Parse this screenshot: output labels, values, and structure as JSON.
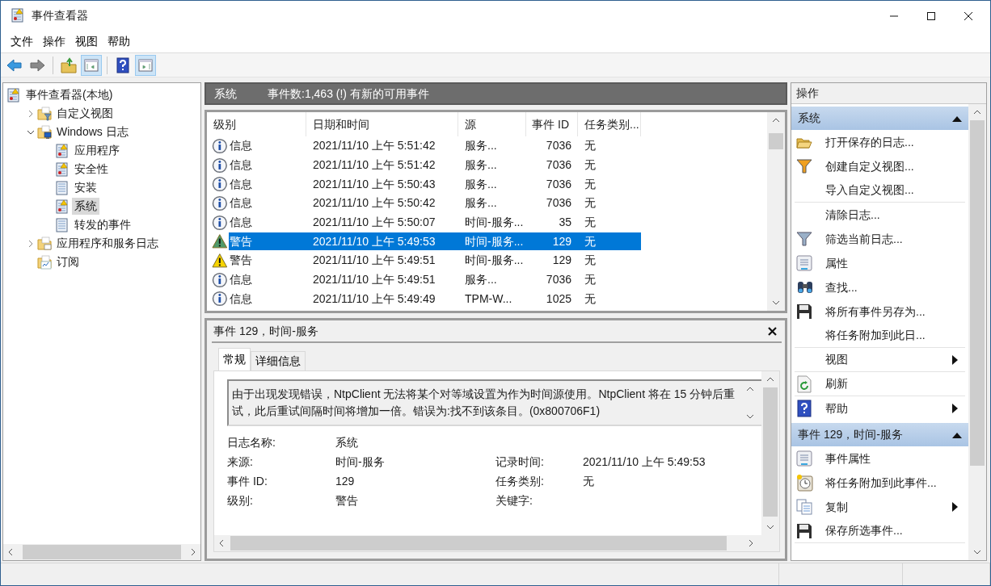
{
  "window": {
    "title": "事件查看器"
  },
  "menu": [
    "文件",
    "操作",
    "视图",
    "帮助"
  ],
  "toolbar": [
    {
      "kind": "back",
      "pressed": false
    },
    {
      "kind": "forward",
      "pressed": false
    },
    {
      "kind": "up",
      "pressed": false
    },
    {
      "kind": "tree-pane",
      "pressed": true
    },
    {
      "kind": "help",
      "pressed": false
    },
    {
      "kind": "action-pane",
      "pressed": true
    }
  ],
  "tree": [
    {
      "label": "事件查看器(本地)",
      "kind": "log",
      "selected": false,
      "children": [
        {
          "label": "自定义视图",
          "kind": "folder-filter",
          "expanded": false,
          "selected": false
        },
        {
          "label": "Windows 日志",
          "kind": "folder-windows",
          "expanded": true,
          "selected": false,
          "children": [
            {
              "label": "应用程序",
              "kind": "log",
              "selected": false
            },
            {
              "label": "安全性",
              "kind": "log",
              "selected": false
            },
            {
              "label": "安装",
              "kind": "page",
              "selected": false
            },
            {
              "label": "系统",
              "kind": "log",
              "selected": true
            },
            {
              "label": "转发的事件",
              "kind": "page",
              "selected": false
            }
          ]
        },
        {
          "label": "应用程序和服务日志",
          "kind": "folder",
          "expanded": false,
          "selected": false
        },
        {
          "label": "订阅",
          "kind": "subscription",
          "selected": false
        }
      ]
    }
  ],
  "list_header": {
    "title": "系统",
    "summary": "事件数:1,463 (!) 有新的可用事件"
  },
  "table": {
    "columns": [
      "级别",
      "日期和时间",
      "源",
      "事件 ID",
      "任务类别..."
    ],
    "rows": [
      {
        "kind": "info",
        "level": "信息",
        "datetime": "2021/11/10 上午 5:51:42",
        "source": "服务...",
        "event_id": "7036",
        "category": "无",
        "selected": false
      },
      {
        "kind": "info",
        "level": "信息",
        "datetime": "2021/11/10 上午 5:51:42",
        "source": "服务...",
        "event_id": "7036",
        "category": "无",
        "selected": false
      },
      {
        "kind": "info",
        "level": "信息",
        "datetime": "2021/11/10 上午 5:50:43",
        "source": "服务...",
        "event_id": "7036",
        "category": "无",
        "selected": false
      },
      {
        "kind": "info",
        "level": "信息",
        "datetime": "2021/11/10 上午 5:50:42",
        "source": "服务...",
        "event_id": "7036",
        "category": "无",
        "selected": false
      },
      {
        "kind": "info",
        "level": "信息",
        "datetime": "2021/11/10 上午 5:50:07",
        "source": "时间-服务...",
        "event_id": "35",
        "category": "无",
        "selected": false
      },
      {
        "kind": "warning",
        "level": "警告",
        "datetime": "2021/11/10 上午 5:49:53",
        "source": "时间-服务...",
        "event_id": "129",
        "category": "无",
        "selected": true
      },
      {
        "kind": "warning",
        "level": "警告",
        "datetime": "2021/11/10 上午 5:49:51",
        "source": "时间-服务...",
        "event_id": "129",
        "category": "无",
        "selected": false
      },
      {
        "kind": "info",
        "level": "信息",
        "datetime": "2021/11/10 上午 5:49:51",
        "source": "服务...",
        "event_id": "7036",
        "category": "无",
        "selected": false
      },
      {
        "kind": "info",
        "level": "信息",
        "datetime": "2021/11/10 上午 5:49:49",
        "source": "TPM-W...",
        "event_id": "1025",
        "category": "无",
        "selected": false
      }
    ]
  },
  "detail": {
    "title": "事件 129，时间-服务",
    "tabs": [
      {
        "label": "常规",
        "selected": true
      },
      {
        "label": "详细信息",
        "selected": false
      }
    ],
    "message": "由于出现发现错误，NtpClient 无法将某个对等域设置为作为时间源使用。NtpClient 将在 15 分钟后重试，此后重试间隔时间将增加一倍。错误为:找不到该条目。(0x800706F1)",
    "fields": [
      [
        {
          "label": "日志名称:",
          "value": "系统"
        }
      ],
      [
        {
          "label": "来源:",
          "value": "时间-服务"
        },
        {
          "label": "记录时间:",
          "value": "2021/11/10 上午 5:49:53"
        }
      ],
      [
        {
          "label": "事件 ID:",
          "value": "129"
        },
        {
          "label": "任务类别:",
          "value": "无"
        }
      ],
      [
        {
          "label": "级别:",
          "value": "警告"
        },
        {
          "label": "关键字:"
        }
      ]
    ]
  },
  "actions": {
    "title": "操作",
    "sections": [
      {
        "title": "系统",
        "expanded": true,
        "items": [
          {
            "label": "打开保存的日志...",
            "kind": "folder-open",
            "group_end": false,
            "submenu": false
          },
          {
            "label": "创建自定义视图...",
            "kind": "funnel-color",
            "group_end": false,
            "submenu": false
          },
          {
            "label": "导入自定义视图...",
            "kind": "plain",
            "group_end": true,
            "submenu": false
          },
          {
            "label": "清除日志...",
            "kind": "plain",
            "group_end": false,
            "submenu": false
          },
          {
            "label": "筛选当前日志...",
            "kind": "funnel",
            "group_end": false,
            "submenu": false
          },
          {
            "label": "属性",
            "kind": "properties",
            "group_end": false,
            "submenu": false
          },
          {
            "label": "查找...",
            "kind": "binoculars",
            "group_end": false,
            "submenu": false
          },
          {
            "label": "将所有事件另存为...",
            "kind": "floppy",
            "group_end": false,
            "submenu": false
          },
          {
            "label": "将任务附加到此日...",
            "kind": "plain",
            "group_end": true,
            "submenu": false
          },
          {
            "label": "视图",
            "kind": "plain",
            "group_end": true,
            "submenu": true
          },
          {
            "label": "刷新",
            "kind": "refresh",
            "group_end": true,
            "submenu": false
          },
          {
            "label": "帮助",
            "kind": "help",
            "group_end": false,
            "submenu": true
          }
        ]
      },
      {
        "title": "事件 129，时间-服务",
        "expanded": true,
        "items": [
          {
            "label": "事件属性",
            "kind": "properties",
            "group_end": false,
            "submenu": false
          },
          {
            "label": "将任务附加到此事件...",
            "kind": "task",
            "group_end": false,
            "submenu": false
          },
          {
            "label": "复制",
            "kind": "copy",
            "group_end": false,
            "submenu": true
          },
          {
            "label": "保存所选事件...",
            "kind": "floppy",
            "group_end": true,
            "submenu": false
          }
        ]
      }
    ]
  }
}
